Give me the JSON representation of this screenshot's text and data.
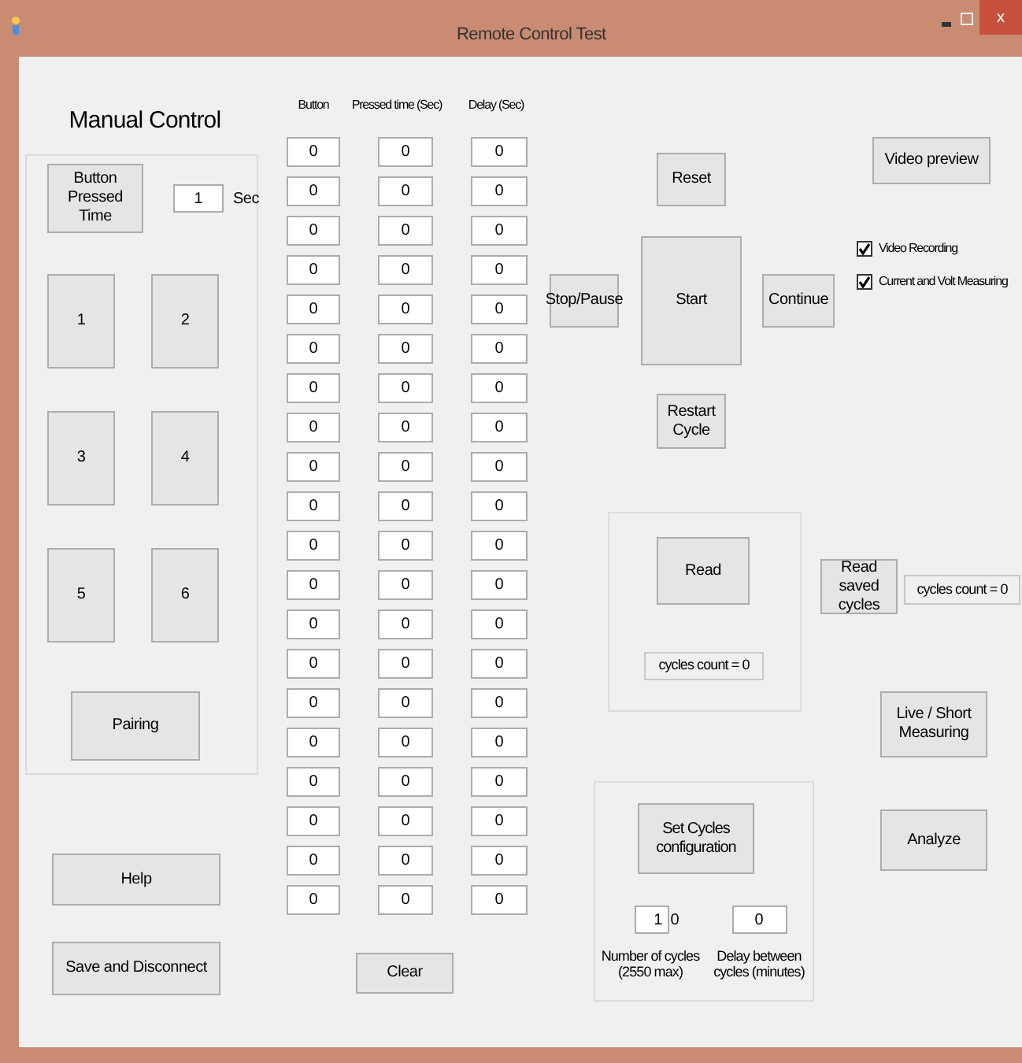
{
  "window": {
    "title": "Remote Control Test",
    "close": "x"
  },
  "manual_control": {
    "title": "Manual Control",
    "pressed_time_button": "Button Pressed Time",
    "pressed_time_value": "1",
    "pressed_time_unit": "Sec",
    "number_buttons": [
      "1",
      "2",
      "3",
      "4",
      "5",
      "6"
    ],
    "pairing_button": "Pairing"
  },
  "help_button": "Help",
  "save_button": "Save and Disconnect",
  "sequence_table": {
    "columns": [
      "Button",
      "Pressed time (Sec)",
      "Delay (Sec)"
    ],
    "rows": [
      [
        "0",
        "0",
        "0"
      ],
      [
        "0",
        "0",
        "0"
      ],
      [
        "0",
        "0",
        "0"
      ],
      [
        "0",
        "0",
        "0"
      ],
      [
        "0",
        "0",
        "0"
      ],
      [
        "0",
        "0",
        "0"
      ],
      [
        "0",
        "0",
        "0"
      ],
      [
        "0",
        "0",
        "0"
      ],
      [
        "0",
        "0",
        "0"
      ],
      [
        "0",
        "0",
        "0"
      ],
      [
        "0",
        "0",
        "0"
      ],
      [
        "0",
        "0",
        "0"
      ],
      [
        "0",
        "0",
        "0"
      ],
      [
        "0",
        "0",
        "0"
      ],
      [
        "0",
        "0",
        "0"
      ],
      [
        "0",
        "0",
        "0"
      ],
      [
        "0",
        "0",
        "0"
      ],
      [
        "0",
        "0",
        "0"
      ],
      [
        "0",
        "0",
        "0"
      ],
      [
        "0",
        "0",
        "0"
      ]
    ],
    "clear_button": "Clear"
  },
  "cycle_controls": {
    "reset": "Reset",
    "stop": "Stop/Pause",
    "start": "Start",
    "continue": "Continue",
    "restart": "Restart Cycle"
  },
  "video_preview_button": "Video preview",
  "options": [
    {
      "label": "Video Recording",
      "checked": true
    },
    {
      "label": "Current and Volt Measuring",
      "checked": true
    }
  ],
  "read_group": {
    "read_button": "Read",
    "cycles_count": "cycles count = 0"
  },
  "read_saved": {
    "button": "Read saved cycles",
    "cycles_count": "cycles count = 0"
  },
  "live_button": "Live / Short Measuring",
  "analyze_button": "Analyze",
  "config_group": {
    "button": "Set Cycles configuration",
    "number_of_cycles": "1",
    "number_of_cycles_suffix": "0",
    "number_label": "Number of cycles (2550 max)",
    "delay": "0",
    "delay_label": "Delay between cycles (minutes)"
  }
}
